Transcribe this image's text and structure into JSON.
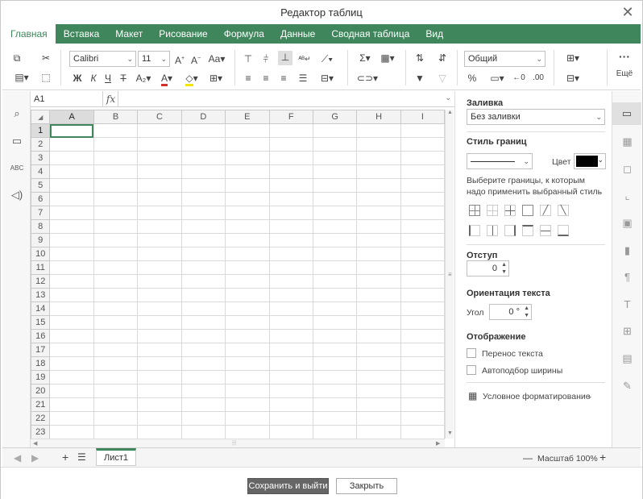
{
  "window": {
    "title": "Редактор таблиц",
    "close": "✕"
  },
  "tabs": [
    "Главная",
    "Вставка",
    "Макет",
    "Рисование",
    "Формула",
    "Данные",
    "Сводная таблица",
    "Вид"
  ],
  "toolbar": {
    "font_name": "Calibri",
    "font_size": "11",
    "number_format": "Общий",
    "more_label": "Ещё",
    "bold": "Ж",
    "italic": "К",
    "underline": "Ч",
    "strike": "Т",
    "font_color_accent": "#d0312d",
    "fill_color_accent": "#f2e600"
  },
  "formula_bar": {
    "cell_ref": "A1",
    "fx": "fx",
    "value": ""
  },
  "grid": {
    "columns": [
      "A",
      "B",
      "C",
      "D",
      "E",
      "F",
      "G",
      "H",
      "I"
    ],
    "rows": [
      "1",
      "2",
      "3",
      "4",
      "5",
      "6",
      "7",
      "8",
      "9",
      "10",
      "11",
      "12",
      "13",
      "14",
      "15",
      "16",
      "17",
      "18",
      "19",
      "20",
      "21",
      "22",
      "23"
    ],
    "selected_cell": "A1"
  },
  "right_panel": {
    "fill_label": "Заливка",
    "fill_value": "Без заливки",
    "border_style_label": "Стиль границ",
    "color_label": "Цвет",
    "border_color": "#000000",
    "border_hint": "Выберите границы, к которым надо применить выбранный стиль",
    "indent_label": "Отступ",
    "indent_value": "0",
    "orientation_label": "Ориентация текста",
    "angle_label": "Угол",
    "angle_value": "0 °",
    "display_label": "Отображение",
    "wrap_text": "Перенос текста",
    "autofit_width": "Автоподбор ширины",
    "conditional_formatting": "Условное форматирование"
  },
  "status": {
    "sheet_name": "Лист1",
    "zoom_label": "Масштаб 100%",
    "zoom_minus": "—",
    "zoom_plus": "+"
  },
  "footer": {
    "save_exit": "Сохранить и выйти",
    "close": "Закрыть"
  },
  "accent_color": "#40865c"
}
